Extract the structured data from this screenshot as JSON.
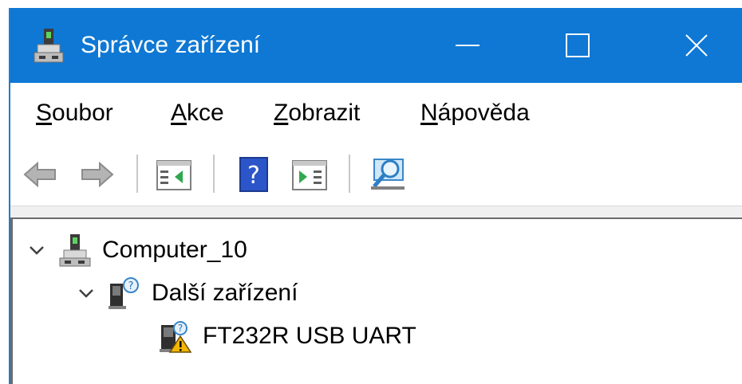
{
  "window": {
    "title": "Správce zařízení",
    "titlebar_color": "#0e78d4",
    "controls": [
      {
        "name": "minimize",
        "icon": "minimize-icon"
      },
      {
        "name": "maximize",
        "icon": "maximize-icon"
      },
      {
        "name": "close",
        "icon": "close-icon"
      }
    ]
  },
  "menu": {
    "items": [
      {
        "accel": "S",
        "rest": "oubor"
      },
      {
        "accel": "A",
        "rest": "kce"
      },
      {
        "accel": "Z",
        "rest": "obrazit"
      },
      {
        "accel": "N",
        "rest": "ápověda"
      }
    ]
  },
  "toolbar": {
    "buttons": [
      {
        "icon": "back-arrow-icon"
      },
      {
        "icon": "forward-arrow-icon"
      },
      {
        "icon": "properties-icon"
      },
      {
        "icon": "help-icon"
      },
      {
        "icon": "update-driver-icon"
      },
      {
        "icon": "scan-hardware-icon"
      }
    ]
  },
  "tree": {
    "root": {
      "label": "Computer_10",
      "icon": "computer-icon",
      "expanded": true
    },
    "category": {
      "label": "Další zařízení",
      "icon": "unknown-device-icon",
      "expanded": true
    },
    "device": {
      "label": "FT232R USB UART",
      "icon": "warning-device-icon",
      "status": "warning"
    }
  },
  "colors": {
    "accent": "#0e78d4",
    "warning": "#f2b705"
  }
}
